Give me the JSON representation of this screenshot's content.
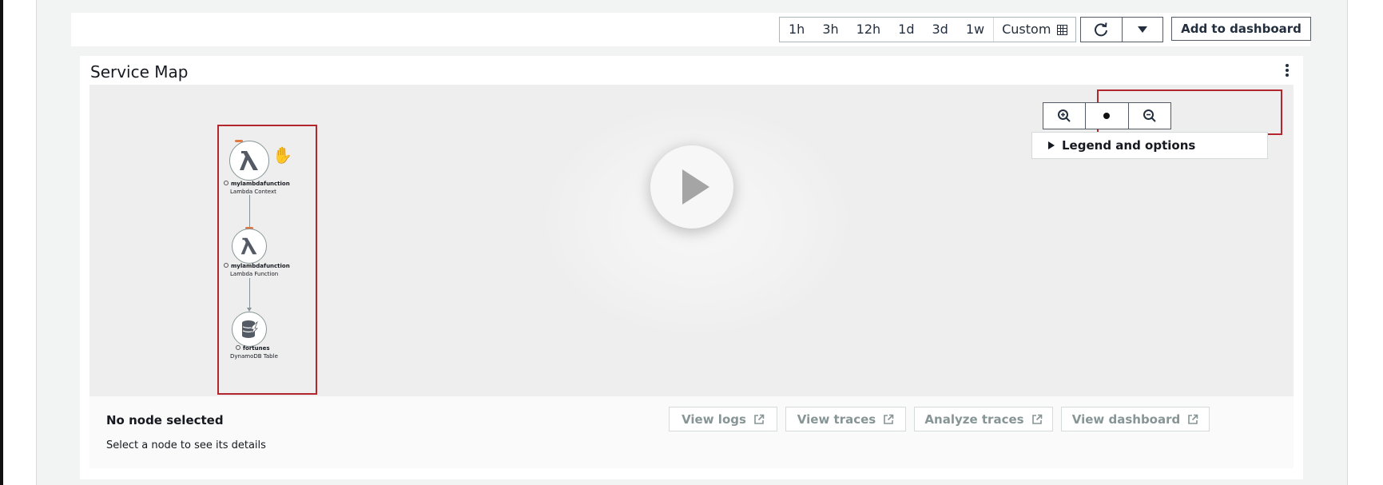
{
  "toolbar": {
    "ranges": [
      "1h",
      "3h",
      "12h",
      "1d",
      "3d",
      "1w"
    ],
    "custom_label": "Custom",
    "add_to_dashboard": "Add to dashboard"
  },
  "panel": {
    "title": "Service Map",
    "legend_label": "Legend and options"
  },
  "nodes": [
    {
      "name": "mylambdafunction",
      "type": "Lambda Context",
      "icon": "lambda-icon"
    },
    {
      "name": "mylambdafunction",
      "type": "Lambda Function",
      "icon": "lambda-icon"
    },
    {
      "name": "fortunes",
      "type": "DynamoDB Table",
      "icon": "dynamodb-icon"
    }
  ],
  "details": {
    "title": "No node selected",
    "subtitle": "Select a node to see its details",
    "buttons": [
      "View logs",
      "View traces",
      "Analyze traces",
      "View dashboard"
    ]
  },
  "colors": {
    "highlight": "#b3262d",
    "node_alert": "#e07941"
  }
}
